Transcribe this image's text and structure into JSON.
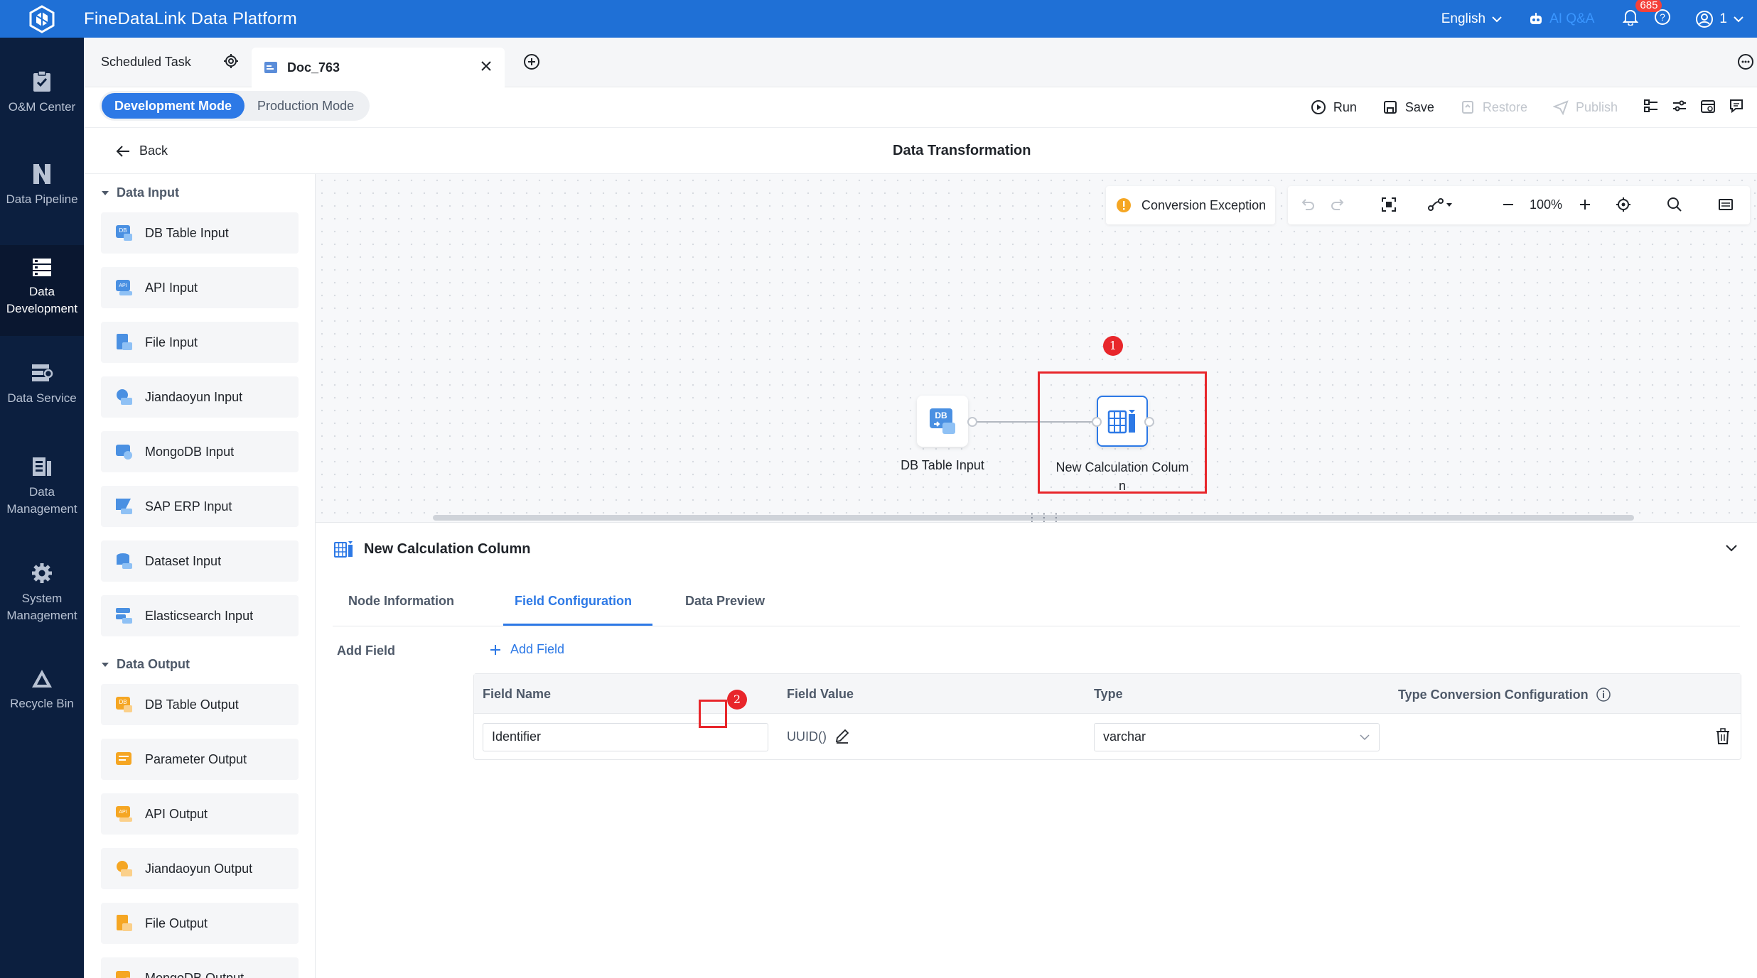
{
  "app": {
    "title": "FineDataLink Data Platform",
    "language": "English",
    "ai_label": "AI Q&A",
    "notification_count": "685",
    "user": "1",
    "brand_color": "#1f70d6"
  },
  "nav": [
    {
      "label": "O&M Center",
      "icon": "clipboard-check-icon"
    },
    {
      "label": "Data Pipeline",
      "icon": "pipeline-icon"
    },
    {
      "label": "Data Development",
      "icon": "data-development-icon"
    },
    {
      "label": "Data Service",
      "icon": "data-service-icon"
    },
    {
      "label": "Data Management",
      "icon": "data-management-icon"
    },
    {
      "label": "System Management",
      "icon": "gear-icon"
    },
    {
      "label": "Recycle Bin",
      "icon": "recycle-icon"
    }
  ],
  "tabs": {
    "scheduled": "Scheduled Task",
    "doc": "Doc_763"
  },
  "modes": {
    "dev": "Development Mode",
    "prod": "Production Mode"
  },
  "toolbar": {
    "run": "Run",
    "save": "Save",
    "restore": "Restore",
    "publish": "Publish"
  },
  "back": "Back",
  "page_title": "Data Transformation",
  "sidepanel": {
    "input_title": "Data Input",
    "inputs": [
      "DB Table Input",
      "API Input",
      "File Input",
      "Jiandaoyun Input",
      "MongoDB Input",
      "SAP ERP Input",
      "Dataset Input",
      "Elasticsearch Input"
    ],
    "output_title": "Data Output",
    "outputs": [
      "DB Table Output",
      "Parameter Output",
      "API Output",
      "Jiandaoyun Output",
      "File Output",
      "MongoDB Output"
    ]
  },
  "canvas": {
    "exception_label": "Conversion Exception",
    "zoom": "100%",
    "node1_label": "DB Table Input",
    "node2_label_line1": "New Calculation Colum",
    "node2_label_line2": "n",
    "badge1": "1",
    "highlight_color": "#e8262b"
  },
  "bottom": {
    "title": "New Calculation Column",
    "tabs": [
      "Node Information",
      "Field Configuration",
      "Data Preview"
    ],
    "add_field_label": "Add Field",
    "add_field_button": "Add Field",
    "columns": [
      "Field Name",
      "Field Value",
      "Type",
      "Type Conversion Configuration"
    ],
    "row": {
      "field_name": "Identifier",
      "field_value": "UUID()",
      "type": "varchar"
    },
    "badge2": "2"
  }
}
